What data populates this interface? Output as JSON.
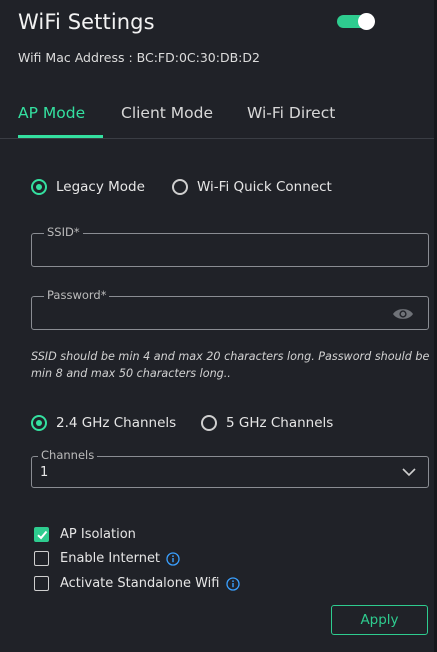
{
  "header": {
    "title": "WiFi Settings",
    "mac_address": "Wifi Mac Address : BC:FD:0C:30:DB:D2",
    "wifi_enabled": true
  },
  "tabs": [
    {
      "label": "AP Mode",
      "active": true
    },
    {
      "label": "Client Mode",
      "active": false
    },
    {
      "label": "Wi-Fi Direct",
      "active": false
    }
  ],
  "mode_radios": [
    {
      "label": "Legacy Mode",
      "checked": true
    },
    {
      "label": "Wi-Fi Quick Connect",
      "checked": false
    }
  ],
  "ssid": {
    "label": "SSID*",
    "value": ""
  },
  "password": {
    "label": "Password*",
    "value": ""
  },
  "hint_text": "SSID should be min 4 and max 20 characters long. Password should be min 8 and max 50 characters long..",
  "channel_radios": [
    {
      "label": "2.4 GHz Channels",
      "checked": true
    },
    {
      "label": "5 GHz Channels",
      "checked": false
    }
  ],
  "channels": {
    "label": "Channels",
    "value": "1"
  },
  "checkboxes": [
    {
      "label": "AP Isolation",
      "checked": true,
      "info": false
    },
    {
      "label": "Enable Internet",
      "checked": false,
      "info": true
    },
    {
      "label": "Activate Standalone Wifi",
      "checked": false,
      "info": true
    }
  ],
  "apply_label": "Apply",
  "colors": {
    "accent": "#34e0a0",
    "background": "#202228",
    "info": "#3aa0ff"
  },
  "icons": {
    "password_toggle": "eye-icon",
    "channel_dropdown": "chevron-down-icon",
    "info": "info-icon",
    "check": "checkmark-icon"
  }
}
